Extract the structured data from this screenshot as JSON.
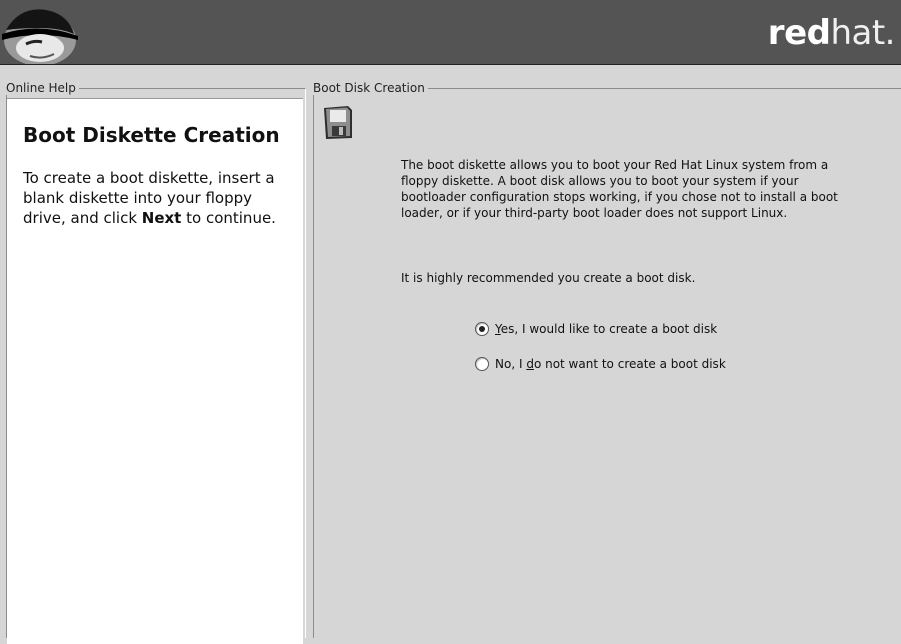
{
  "header": {
    "brand_bold": "red",
    "brand_light": "hat."
  },
  "help_panel": {
    "legend": "Online Help",
    "title": "Boot Diskette Creation",
    "body_before": "To create a boot diskette, insert a blank diskette into your floppy drive, and click ",
    "body_bold": "Next",
    "body_after": " to continue."
  },
  "main_panel": {
    "legend": "Boot Disk Creation",
    "icon": "floppy-disk-icon",
    "description": "The boot diskette allows you to boot your Red Hat Linux system from a floppy diskette.  A boot disk allows you to boot your system if your bootloader configuration stops working, if you chose not to install a boot loader, or if your third-party boot loader does not support Linux.",
    "recommendation": "It is highly recommended you create a boot disk.",
    "options": [
      {
        "mnemonic": "Y",
        "rest_before": "",
        "rest_after": "es, I would like to create a boot disk",
        "selected": true
      },
      {
        "mnemonic": "d",
        "rest_before": "No, I ",
        "rest_after": "o not want to create a boot disk",
        "selected": false
      }
    ]
  },
  "colors": {
    "header_bg": "#545454",
    "window_bg": "#d6d6d6",
    "help_bg": "#ffffff"
  }
}
